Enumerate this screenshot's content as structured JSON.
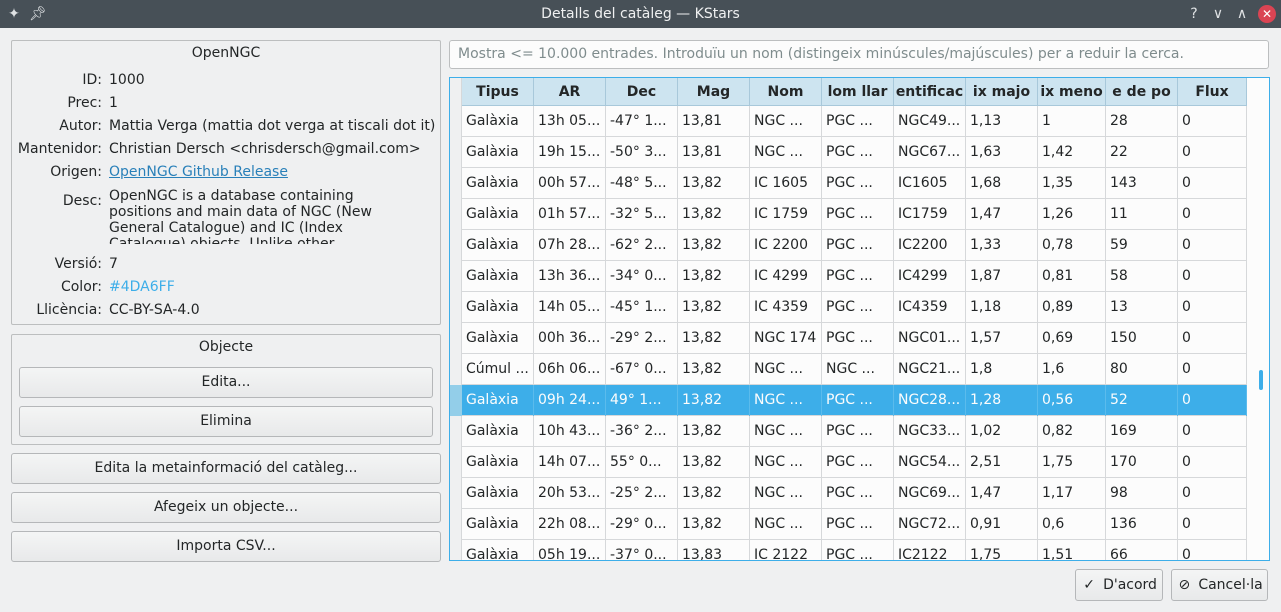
{
  "window": {
    "title": "Detalls del catàleg — KStars",
    "controls": [
      "help-icon",
      "minimize-icon",
      "maximize-icon",
      "close-icon"
    ]
  },
  "info": {
    "heading": "OpenNGC",
    "id_label": "ID:",
    "id_value": "1000",
    "prec_label": "Prec:",
    "prec_value": "1",
    "author_label": "Autor:",
    "author_value": "Mattia Verga (mattia dot verga at tiscali dot it)",
    "maintainer_label": "Mantenidor:",
    "maintainer_value": "Christian Dersch <chrisdersch@gmail.com>",
    "origin_label": "Origen:",
    "origin_value": "OpenNGC Github Release",
    "desc_label": "Desc:",
    "desc_value": "OpenNGC is a database containing positions and main data of NGC (New General Catalogue) and IC (Index Catalogue) objects. Unlike other",
    "version_label": "Versió:",
    "version_value": "7",
    "color_label": "Color:",
    "color_value": "#4DA6FF",
    "license_label": "Llicència:",
    "license_value": "CC-BY-SA-4.0"
  },
  "object": {
    "heading": "Objecte",
    "edit_label": "Edita...",
    "delete_label": "Elimina"
  },
  "actions": {
    "edit_meta_label": "Edita la metainformació del catàleg...",
    "add_object_label": "Afegeix un objecte...",
    "import_csv_label": "Importa CSV..."
  },
  "search": {
    "placeholder": "Mostra <= 10.000 entrades. Introduïu un nom (distingeix minúscules/majúscules) per a reduir la cerca."
  },
  "table": {
    "columns": [
      "Tipus",
      "AR",
      "Dec",
      "Mag",
      "Nom",
      "lom llar",
      "entificac",
      "ix majo",
      "ix meno",
      "e de po",
      "Flux"
    ],
    "rows": [
      [
        "Galàxia",
        "13h 05...",
        "-47° 1...",
        "13,81",
        "NGC ...",
        "PGC ...",
        "NGC49...",
        "1,13",
        "1",
        "28",
        "0"
      ],
      [
        "Galàxia",
        "19h 15...",
        "-50° 3...",
        "13,81",
        "NGC ...",
        "PGC ...",
        "NGC67...",
        "1,63",
        "1,42",
        "22",
        "0"
      ],
      [
        "Galàxia",
        "00h 57...",
        "-48° 5...",
        "13,82",
        "IC 1605",
        "PGC ...",
        "IC1605",
        "1,68",
        "1,35",
        "143",
        "0"
      ],
      [
        "Galàxia",
        "01h 57...",
        "-32° 5...",
        "13,82",
        "IC 1759",
        "PGC ...",
        "IC1759",
        "1,47",
        "1,26",
        "11",
        "0"
      ],
      [
        "Galàxia",
        "07h 28...",
        "-62° 2...",
        "13,82",
        "IC 2200",
        "PGC ...",
        "IC2200",
        "1,33",
        "0,78",
        "59",
        "0"
      ],
      [
        "Galàxia",
        "13h 36...",
        "-34° 0...",
        "13,82",
        "IC 4299",
        "PGC ...",
        "IC4299",
        "1,87",
        "0,81",
        "58",
        "0"
      ],
      [
        "Galàxia",
        "14h 05...",
        "-45° 1...",
        "13,82",
        "IC 4359",
        "PGC ...",
        "IC4359",
        "1,18",
        "0,89",
        "13",
        "0"
      ],
      [
        "Galàxia",
        "00h 36...",
        "-29° 2...",
        "13,82",
        "NGC 174",
        "PGC ...",
        "NGC01...",
        "1,57",
        "0,69",
        "150",
        "0"
      ],
      [
        "Cúmul ...",
        "06h 06...",
        "-67° 0...",
        "13,82",
        "NGC ...",
        "NGC ...",
        "NGC21...",
        "1,8",
        "1,6",
        "80",
        "0"
      ],
      [
        "Galàxia",
        "09h 24...",
        "49° 1...",
        "13,82",
        "NGC ...",
        "PGC ...",
        "NGC28...",
        "1,28",
        "0,56",
        "52",
        "0"
      ],
      [
        "Galàxia",
        "10h 43...",
        "-36° 2...",
        "13,82",
        "NGC ...",
        "PGC ...",
        "NGC33...",
        "1,02",
        "0,82",
        "169",
        "0"
      ],
      [
        "Galàxia",
        "14h 07...",
        "55° 0...",
        "13,82",
        "NGC ...",
        "PGC ...",
        "NGC54...",
        "2,51",
        "1,75",
        "170",
        "0"
      ],
      [
        "Galàxia",
        "20h 53...",
        "-25° 2...",
        "13,82",
        "NGC ...",
        "PGC ...",
        "NGC69...",
        "1,47",
        "1,17",
        "98",
        "0"
      ],
      [
        "Galàxia",
        "22h 08...",
        "-29° 0...",
        "13,82",
        "NGC ...",
        "PGC ...",
        "NGC72...",
        "0,91",
        "0,6",
        "136",
        "0"
      ],
      [
        "Galàxia",
        "05h 19...",
        "-37° 0...",
        "13,83",
        "IC 2122",
        "PGC ...",
        "IC2122",
        "1,75",
        "1,51",
        "66",
        "0"
      ]
    ],
    "selected_row": 9
  },
  "dialog": {
    "ok_label": "D'acord",
    "cancel_label": "Cancel·la"
  },
  "colors": {
    "accent": "#3daee9",
    "titlebar": "#475057",
    "close": "#da4453"
  }
}
